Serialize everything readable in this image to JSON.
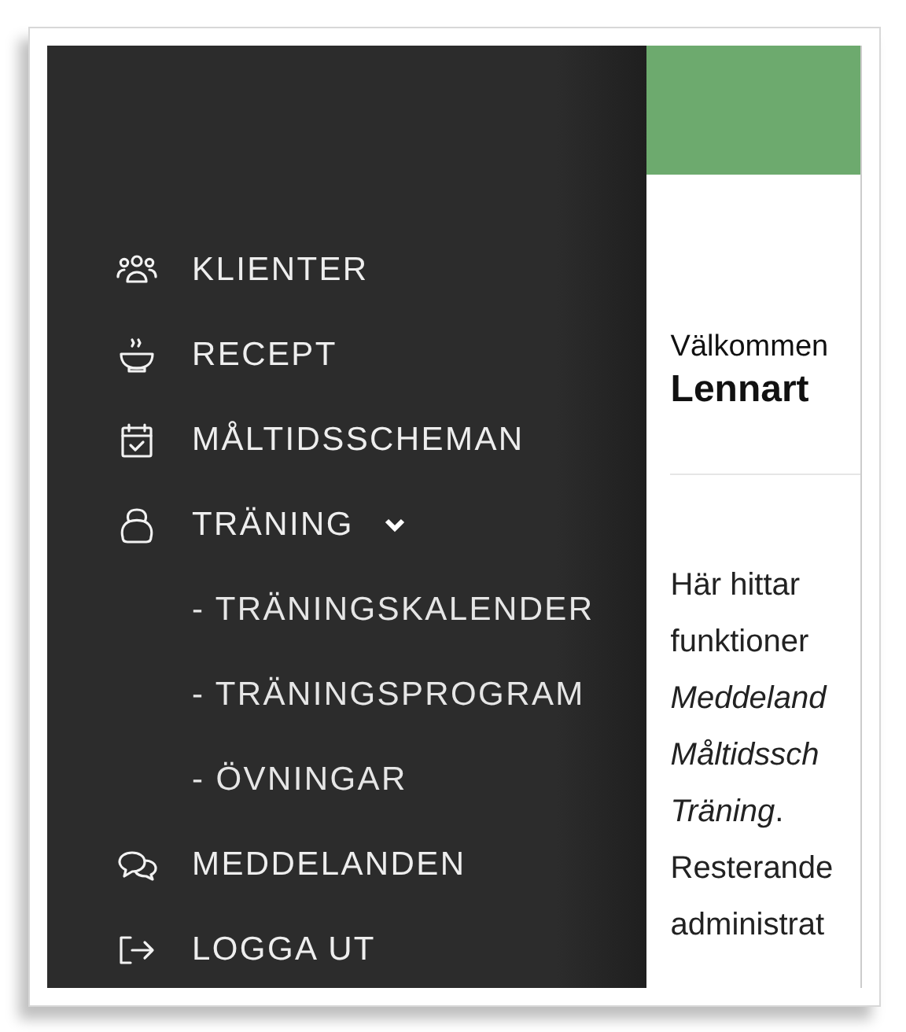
{
  "menu": [
    {
      "kind": "item",
      "label": "KLIENTER"
    },
    {
      "kind": "item",
      "label": "RECEPT"
    },
    {
      "kind": "item",
      "label": "MÅLTIDSSCHEMAN"
    },
    {
      "kind": "item",
      "label": "TRÄNING",
      "expanded": true,
      "children": [
        {
          "kind": "subitem",
          "label": "- TRÄNINGSKALENDER"
        },
        {
          "kind": "subitem",
          "label": "- TRÄNINGSPROGRAM"
        },
        {
          "kind": "subitem",
          "label": "- ÖVNINGAR"
        }
      ]
    },
    {
      "kind": "item",
      "label": "MEDDELANDEN"
    },
    {
      "kind": "item",
      "label": "LOGGA UT"
    }
  ],
  "main": {
    "greeting": "Välkommen",
    "name": "Lennart",
    "intro_lines": [
      "Här hittar",
      "funktioner",
      "*Meddeland*",
      "*Måltidssch*",
      "*Träning*.",
      "Resterande",
      "administrat"
    ]
  }
}
